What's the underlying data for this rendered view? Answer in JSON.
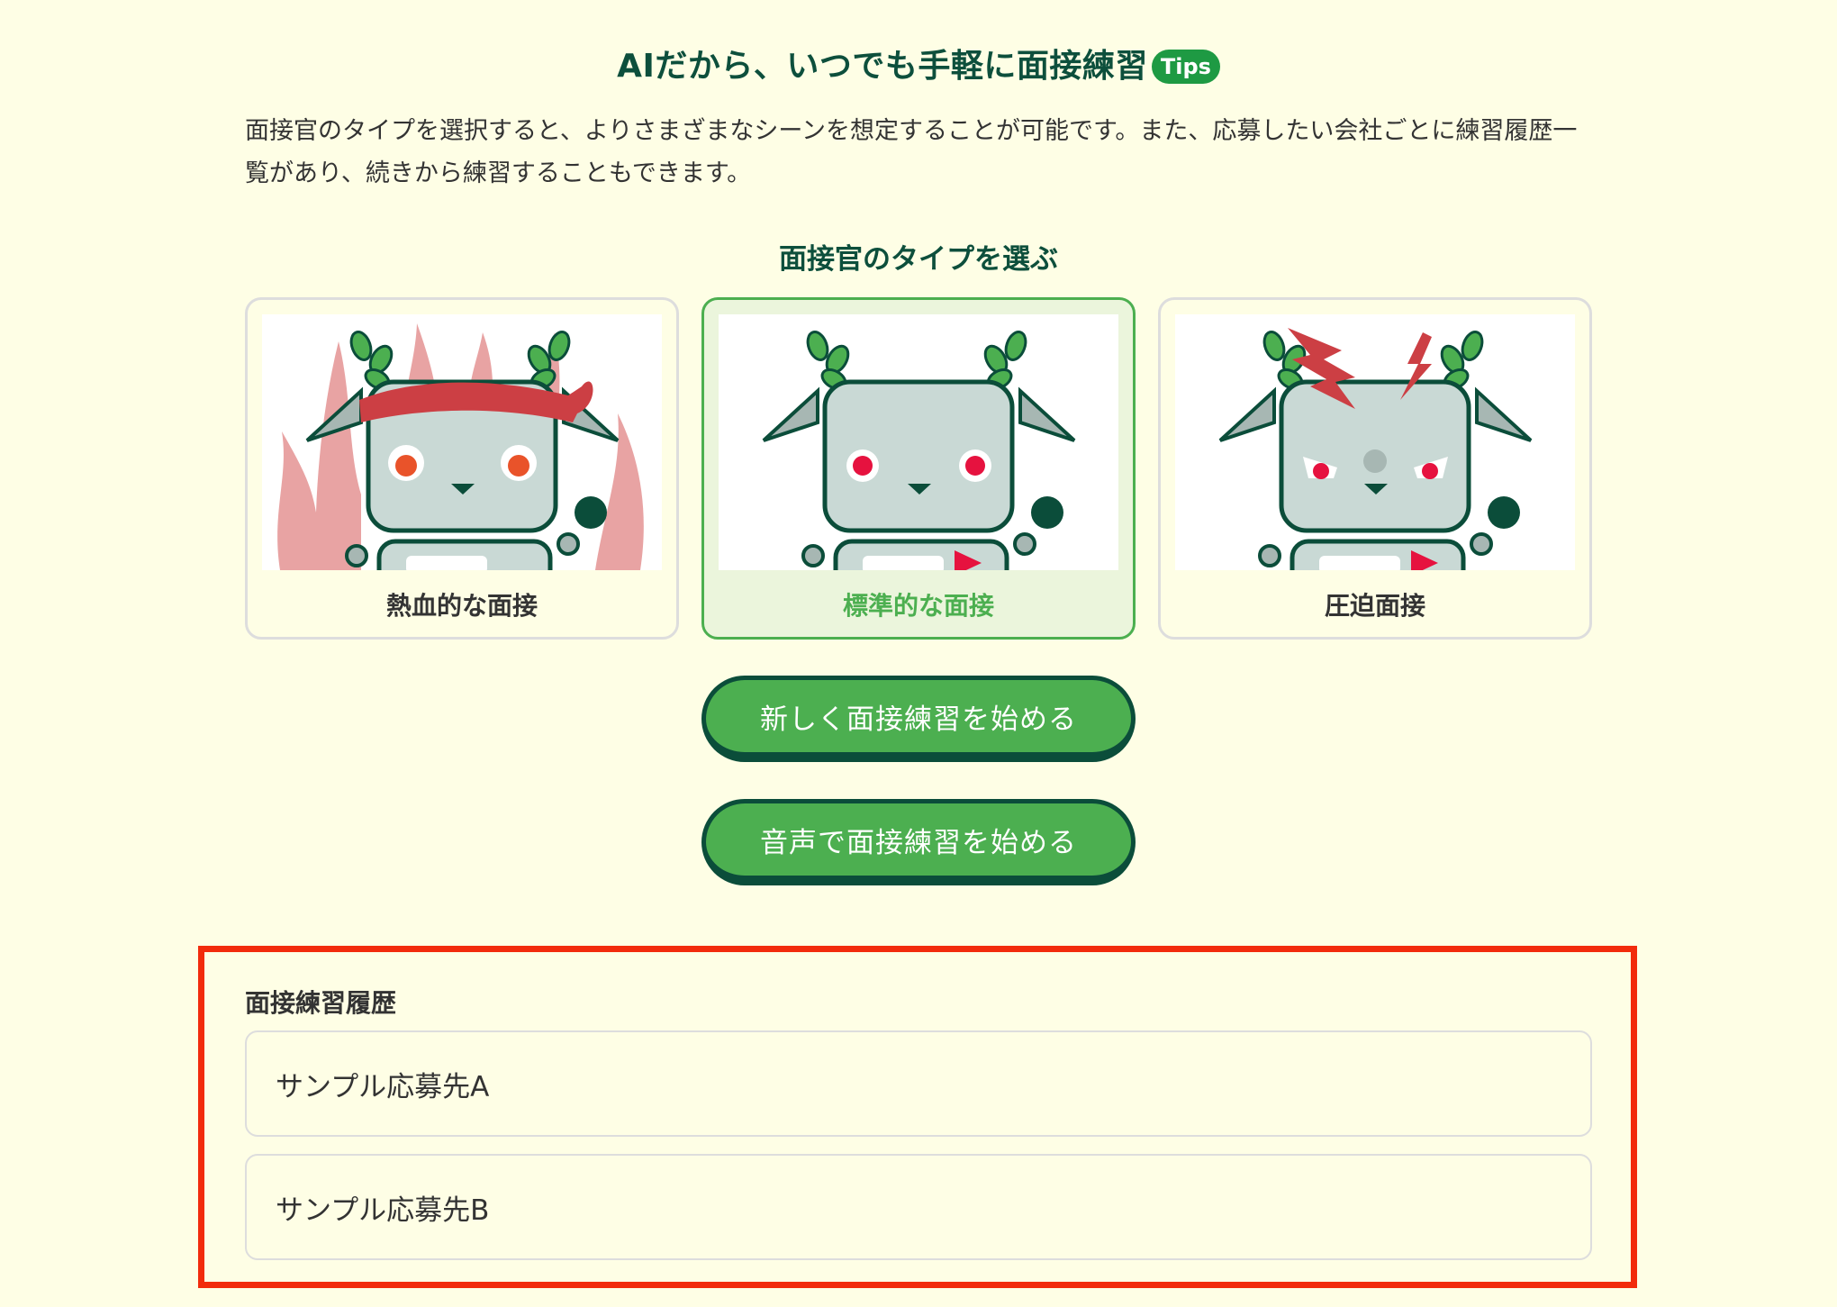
{
  "header": {
    "title": "AIだから、いつでも手軽に面接練習",
    "tips_badge": "Tips"
  },
  "intro": "面接官のタイプを選択すると、よりさまざまなシーンを想定することが可能です。また、応募したい会社ごとに練習履歴一覧があり、続きから練習することもできます。",
  "interviewer": {
    "label": "面接官のタイプを選ぶ",
    "options": [
      {
        "label": "熱血的な面接",
        "selected": false,
        "icon": "passionate-robot"
      },
      {
        "label": "標準的な面接",
        "selected": true,
        "icon": "standard-robot"
      },
      {
        "label": "圧迫面接",
        "selected": false,
        "icon": "pressure-robot"
      }
    ]
  },
  "actions": {
    "start_new": "新しく面接練習を始める",
    "start_voice": "音声で面接練習を始める"
  },
  "history": {
    "label": "面接練習履歴",
    "items": [
      "サンプル応募先A",
      "サンプル応募先B"
    ]
  },
  "colors": {
    "background": "#fefee5",
    "primary_green": "#4caf50",
    "dark_green": "#0b4d3a",
    "highlight_red": "#f22b0c"
  }
}
